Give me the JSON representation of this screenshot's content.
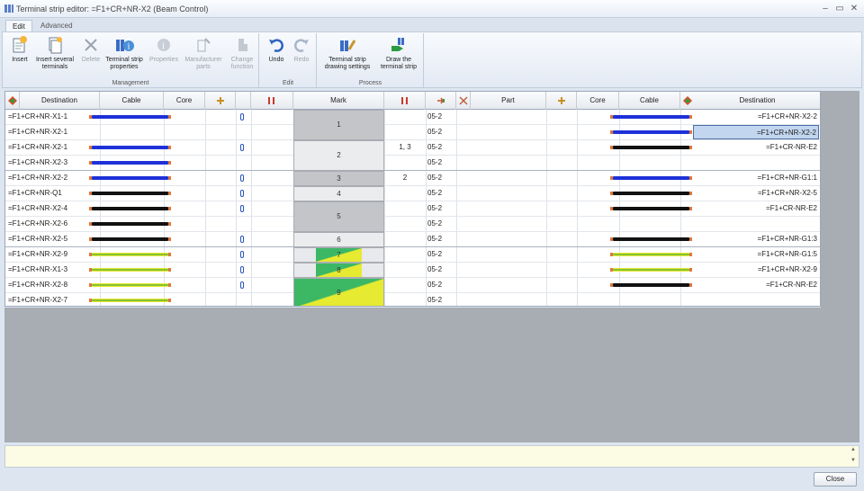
{
  "window": {
    "title": "Terminal strip editor: =F1+CR+NR-X2 (Beam Control)",
    "controls": [
      "‒",
      "▭",
      "✕"
    ]
  },
  "tabs": [
    "Edit",
    "Advanced"
  ],
  "ribbon": {
    "groups": [
      {
        "title": "Management",
        "buttons": [
          "Insert",
          "Insert several terminals",
          "Delete",
          "Terminal strip properties",
          "Properties",
          "Manufacturer parts",
          "Change function"
        ]
      },
      {
        "title": "Edit",
        "buttons": [
          "Undo",
          "Redo"
        ]
      },
      {
        "title": "Process",
        "buttons": [
          "Terminal strip drawing settings",
          "Draw the terminal strip"
        ]
      }
    ]
  },
  "columns": {
    "left_destination": "Destination",
    "left_cable": "Cable",
    "left_core": "Core",
    "mark": "Mark",
    "part": "Part",
    "right_core": "Core",
    "right_cable": "Cable",
    "right_destination": "Destination"
  },
  "rows": [
    {
      "ldest": "=F1+CR+NR-X1-1",
      "lwire": "blue",
      "jumper": "",
      "sheet": "05-2",
      "rwire": "blue",
      "rdest": "=F1+CR+NR-X2-2"
    },
    {
      "ldest": "=F1+CR+NR-X2-1",
      "lwire": "",
      "jumper": "",
      "sheet": "05-2",
      "rwire": "blue",
      "rdest": "=F1+CR+NR-X2-2"
    },
    {
      "ldest": "=F1+CR+NR-X2-1",
      "lwire": "blue",
      "jumper": "1, 3",
      "sheet": "05-2",
      "rwire": "black",
      "rdest": "=F1+CR-NR-E2"
    },
    {
      "ldest": "=F1+CR+NR-X2-3",
      "lwire": "blue",
      "jumper": "",
      "sheet": "05-2",
      "rwire": "",
      "rdest": ""
    },
    {
      "ldest": "=F1+CR+NR-X2-2",
      "lwire": "blue",
      "jumper": "2",
      "sheet": "05-2",
      "rwire": "blue",
      "rdest": "=F1+CR+NR-G1:1"
    },
    {
      "ldest": "=F1+CR+NR-Q1",
      "lwire": "black",
      "jumper": "",
      "sheet": "05-2",
      "rwire": "black",
      "rdest": "=F1+CR+NR-X2-5"
    },
    {
      "ldest": "=F1+CR+NR-X2-4",
      "lwire": "black",
      "jumper": "",
      "sheet": "05-2",
      "rwire": "black",
      "rdest": "=F1+CR-NR-E2"
    },
    {
      "ldest": "=F1+CR+NR-X2-6",
      "lwire": "black",
      "jumper": "",
      "sheet": "05-2",
      "rwire": "",
      "rdest": ""
    },
    {
      "ldest": "=F1+CR+NR-X2-5",
      "lwire": "black",
      "jumper": "",
      "sheet": "05-2",
      "rwire": "black",
      "rdest": "=F1+CR+NR-G1:3"
    },
    {
      "ldest": "=F1+CR+NR-X2-9",
      "lwire": "gy",
      "jumper": "",
      "sheet": "05-2",
      "rwire": "gy",
      "rdest": "=F1+CR+NR-G1:5"
    },
    {
      "ldest": "=F1+CR+NR-X1-3",
      "lwire": "gy",
      "jumper": "",
      "sheet": "05-2",
      "rwire": "gy",
      "rdest": "=F1+CR+NR-X2-9"
    },
    {
      "ldest": "=F1+CR+NR-X2-8",
      "lwire": "gy",
      "jumper": "",
      "sheet": "05-2",
      "rwire": "black",
      "rdest": "=F1+CR-NR-E2"
    },
    {
      "ldest": "=F1+CR+NR-X2-7",
      "lwire": "gy",
      "jumper": "",
      "sheet": "05-2",
      "rwire": "",
      "rdest": ""
    }
  ],
  "marks": [
    {
      "label": "1",
      "start": 0,
      "span": 2,
      "style": "grey"
    },
    {
      "label": "2",
      "start": 2,
      "span": 2,
      "style": "light"
    },
    {
      "label": "3",
      "start": 4,
      "span": 1,
      "style": "grey"
    },
    {
      "label": "4",
      "start": 5,
      "span": 1,
      "style": "light"
    },
    {
      "label": "5",
      "start": 6,
      "span": 2,
      "style": "grey"
    },
    {
      "label": "6",
      "start": 8,
      "span": 1,
      "style": "light"
    },
    {
      "label": "7",
      "start": 9,
      "span": 1,
      "style": "pe"
    },
    {
      "label": "8",
      "start": 10,
      "span": 1,
      "style": "pe"
    },
    {
      "label": "9",
      "start": 11,
      "span": 2,
      "style": "pe"
    }
  ],
  "bridges": [
    0,
    2,
    4,
    5,
    6,
    8,
    9,
    10,
    11
  ],
  "selected_row": 1,
  "footer": {
    "close": "Close"
  },
  "colors": {
    "blue": "#1d31d8",
    "black": "#111111",
    "pe_green": "#2b9b3a",
    "pe_yellow": "#e6ea30"
  }
}
